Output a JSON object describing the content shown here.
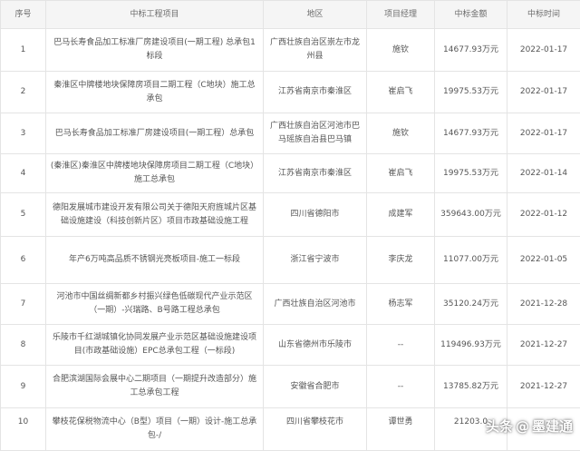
{
  "columns": [
    "序号",
    "中标工程项目",
    "地区",
    "项目经理",
    "中标金额",
    "中标时间"
  ],
  "rows": [
    {
      "no": "1",
      "project": "巴马长寿食品加工标准厂房建设项目(一期工程) 总承包1标段",
      "region": "广西壮族自治区崇左市龙州县",
      "manager": "施钦",
      "amount": "14677.93万元",
      "date": "2022-01-17"
    },
    {
      "no": "2",
      "project": "秦淮区中牌楼地块保障房项目二期工程（C地块）施工总承包",
      "region": "江苏省南京市秦淮区",
      "manager": "崔启飞",
      "amount": "19975.53万元",
      "date": "2022-01-17"
    },
    {
      "no": "3",
      "project": "巴马长寿食品加工标准厂房建设项目(一期工程）总承包",
      "region": "广西壮族自治区河池市巴马瑶族自治县巴马镇",
      "manager": "施钦",
      "amount": "14677.93万元",
      "date": "2022-01-17"
    },
    {
      "no": "4",
      "project": "(秦淮区)秦淮区中牌楼地块保障房项目二期工程（C地块）施工总承包",
      "region": "江苏省南京市秦淮区",
      "manager": "崔启飞",
      "amount": "19975.53万元",
      "date": "2022-01-14"
    },
    {
      "no": "5",
      "project": "德阳发展城市建设开发有限公司关于德阳天府旌城片区基础设施建设（科技创新片区）项目市政基础设施工程",
      "region": "四川省德阳市",
      "manager": "成建军",
      "amount": "359643.00万元",
      "date": "2022-01-12"
    },
    {
      "no": "6",
      "project": "年产6万吨高品质不锈钢光亮板项目-施工一标段",
      "region": "浙江省宁波市",
      "manager": "李庆龙",
      "amount": "11077.00万元",
      "date": "2022-01-05"
    },
    {
      "no": "7",
      "project": "河池市中国丝绸新都乡村振兴绿色低碳现代产业示范区（一期）-兴瑞路、B号路工程总承包",
      "region": "广西壮族自治区河池市",
      "manager": "杨志军",
      "amount": "35120.24万元",
      "date": "2021-12-28"
    },
    {
      "no": "8",
      "project": "乐陵市千红湖城镇化协同发展产业示范区基础设施建设项目(市政基础设施）EPC总承包工程（一标段)",
      "region": "山东省德州市乐陵市",
      "manager": "--",
      "amount": "119496.93万元",
      "date": "2021-12-27"
    },
    {
      "no": "9",
      "project": "合肥滨湖国际会展中心二期项目（一期提升改造部分）施工总承包工程",
      "region": "安徽省合肥市",
      "manager": "--",
      "amount": "13785.82万元",
      "date": "2021-12-27"
    },
    {
      "no": "10",
      "project": "攀枝花保税物流中心（B型）项目（一期）设计-施工总承包-/",
      "region": "四川省攀枝花市",
      "manager": "谭世勇",
      "amount": "21203.0",
      "date": ""
    }
  ],
  "watermark": {
    "source": "头条",
    "at": "@",
    "author": "墨建通"
  }
}
